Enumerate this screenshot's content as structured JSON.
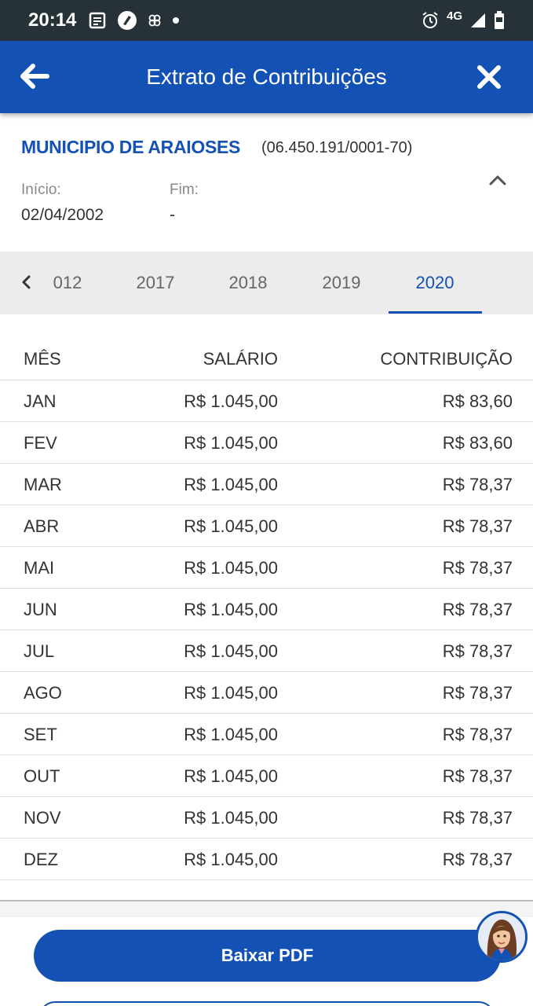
{
  "status_bar": {
    "time": "20:14",
    "left_icons": [
      "news-icon",
      "speed-icon",
      "fan-icon",
      "dot-icon"
    ],
    "network": "4G",
    "right_icons": [
      "alarm-icon",
      "signal-icon",
      "battery-icon"
    ]
  },
  "app_bar": {
    "title": "Extrato de Contribuições",
    "back_icon": "arrow-left-icon",
    "close_icon": "close-icon",
    "color": "#1351b4"
  },
  "employer": {
    "name": "MUNICIPIO DE ARAIOSES",
    "cnpj": "(06.450.191/0001-70)",
    "inicio_label": "Início:",
    "inicio_value": "02/04/2002",
    "fim_label": "Fim:",
    "fim_value": "-"
  },
  "year_tabs": {
    "items": [
      "012",
      "2017",
      "2018",
      "2019",
      "2020"
    ],
    "selected": "2020"
  },
  "table": {
    "headers": {
      "mes": "MÊS",
      "salario": "SALÁRIO",
      "contribuicao": "CONTRIBUIÇÃO"
    },
    "rows": [
      {
        "mes": "JAN",
        "salario": "R$ 1.045,00",
        "contribuicao": "R$ 83,60"
      },
      {
        "mes": "FEV",
        "salario": "R$ 1.045,00",
        "contribuicao": "R$ 83,60"
      },
      {
        "mes": "MAR",
        "salario": "R$ 1.045,00",
        "contribuicao": "R$ 78,37"
      },
      {
        "mes": "ABR",
        "salario": "R$ 1.045,00",
        "contribuicao": "R$ 78,37"
      },
      {
        "mes": "MAI",
        "salario": "R$ 1.045,00",
        "contribuicao": "R$ 78,37"
      },
      {
        "mes": "JUN",
        "salario": "R$ 1.045,00",
        "contribuicao": "R$ 78,37"
      },
      {
        "mes": "JUL",
        "salario": "R$ 1.045,00",
        "contribuicao": "R$ 78,37"
      },
      {
        "mes": "AGO",
        "salario": "R$ 1.045,00",
        "contribuicao": "R$ 78,37"
      },
      {
        "mes": "SET",
        "salario": "R$ 1.045,00",
        "contribuicao": "R$ 78,37"
      },
      {
        "mes": "OUT",
        "salario": "R$ 1.045,00",
        "contribuicao": "R$ 78,37"
      },
      {
        "mes": "NOV",
        "salario": "R$ 1.045,00",
        "contribuicao": "R$ 78,37"
      },
      {
        "mes": "DEZ",
        "salario": "R$ 1.045,00",
        "contribuicao": "R$ 78,37"
      }
    ]
  },
  "actions": {
    "download_pdf": "Baixar PDF"
  }
}
